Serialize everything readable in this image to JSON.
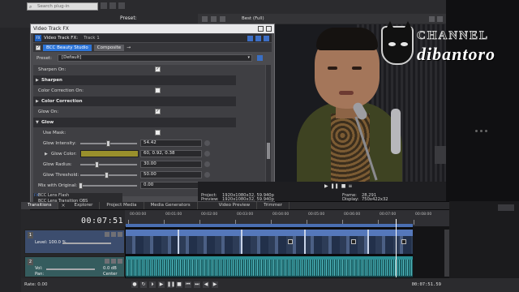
{
  "top": {
    "search_placeholder": "Search plug-in",
    "preset_label": "Preset:",
    "quality": "Best (Full)"
  },
  "logo": {
    "channel": "CHANNEL",
    "name": "dibantoro"
  },
  "dialog": {
    "title": "Video Track FX",
    "fx_label": "Video Track FX:",
    "track": "Track 1",
    "plugin_name": "BCC Beauty Studio",
    "composite": "Composite",
    "preset_label": "Preset:",
    "preset_value": "[Default]",
    "params": {
      "sharpen_on": "Sharpen On:",
      "sharpen_section": "Sharpen",
      "color_correction_on": "Color Correction On:",
      "color_correction_section": "Color Correction",
      "glow_on": "Glow On:",
      "glow_section": "Glow",
      "use_mask": "Use Mask:",
      "glow_intensity_label": "Glow Intensity:",
      "glow_intensity_value": "54.42",
      "glow_color_label": "Glow Color:",
      "glow_color_value": "60, 0.92, 0.38",
      "glow_radius_label": "Glow Radius:",
      "glow_radius_value": "30.00",
      "glow_threshold_label": "Glow Threshold:",
      "glow_threshold_value": "50.00",
      "mix_label": "Mix with Original:",
      "mix_value": "0.00"
    },
    "fx_list": [
      "BCC Lens Flash",
      "BCC Lens Transition OBS"
    ]
  },
  "preview_info": {
    "project": "Project:",
    "project_val": "1920x1080x32, 59.940p",
    "preview": "Preview:",
    "preview_val": "1920x1080x32, 59.940p",
    "video_preview": "Video Preview:",
    "frame": "Frame:",
    "frame_val": "28,291",
    "display": "Display:",
    "display_val": "750x422x32"
  },
  "tabs": [
    "Transitions",
    "Explorer",
    "Project Media",
    "Media Generators",
    "Video Preview",
    "Trimmer"
  ],
  "timeline": {
    "timecode": "00:07:51.59",
    "ticks": [
      "00:00:00",
      "00:01:00",
      "00:02:00",
      "00:03:00",
      "00:04:00",
      "00:05:00",
      "00:06:00",
      "00:07:00",
      "00:08:00"
    ],
    "video_track": {
      "num": "1",
      "level": "Level: 100.0 %"
    },
    "audio_track": {
      "num": "2",
      "vol": "Vol:",
      "vol_val": "0.0 dB",
      "pan": "Pan:",
      "pan_val": "Center"
    }
  },
  "transport": {
    "rate": "Rate: 0.00",
    "end_time": "00:07:51.59"
  }
}
